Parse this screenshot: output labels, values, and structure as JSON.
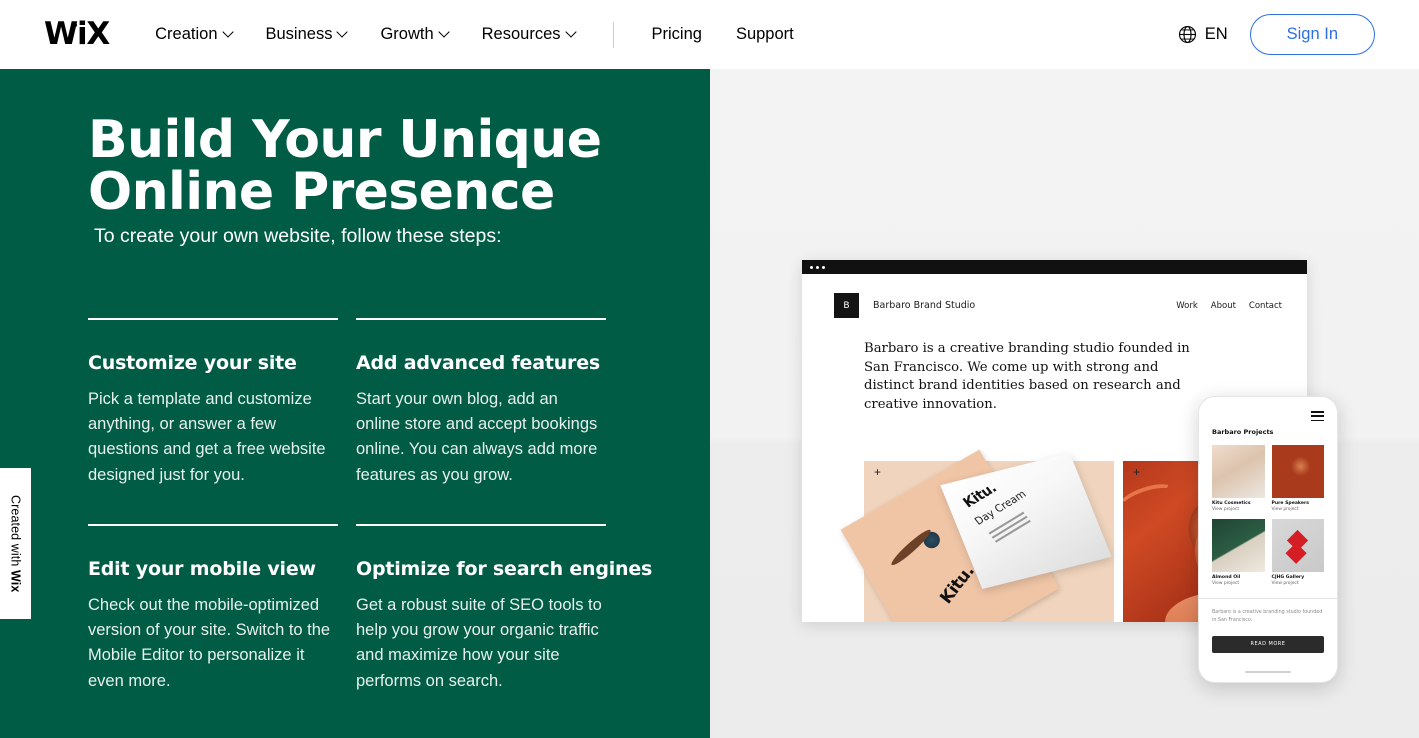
{
  "header": {
    "logo_text": "WiX",
    "nav_items": [
      {
        "label": "Creation",
        "has_chevron": true
      },
      {
        "label": "Business",
        "has_chevron": true
      },
      {
        "label": "Growth",
        "has_chevron": true
      },
      {
        "label": "Resources",
        "has_chevron": true
      }
    ],
    "nav_items_right": [
      {
        "label": "Pricing"
      },
      {
        "label": "Support"
      }
    ],
    "language": "EN",
    "signin_label": "Sign In"
  },
  "hero": {
    "title_line1": "Build Your Unique",
    "title_line2": "Online Presence",
    "subtitle": "To create your own website, follow these steps:",
    "cards": [
      {
        "title": "Customize your site",
        "body": "Pick a template and customize anything, or answer a few questions and get a free website designed just for you."
      },
      {
        "title": "Add advanced features",
        "body": "Start your own blog, add an online store and accept bookings online. You can always add more features as you grow."
      },
      {
        "title": "Edit your mobile view",
        "body": "Check out the mobile-optimized version of your site. Switch to the Mobile Editor to personalize it even more."
      },
      {
        "title": "Optimize for search engines",
        "body": "Get a robust suite of SEO tools to help you grow your organic traffic and maximize how your site performs on search."
      }
    ]
  },
  "created_badge": {
    "prefix": "Created with ",
    "brand": "Wix"
  },
  "preview": {
    "desktop": {
      "logo_initial": "B",
      "brand": "Barbaro Brand Studio",
      "nav": [
        "Work",
        "About",
        "Contact"
      ],
      "paragraph": "Barbaro is a creative branding studio founded in San Francisco. We come up with strong and distinct brand identities based on research and creative innovation.",
      "plus_symbol": "+",
      "product_brand": "Kitu.",
      "product_name": "Day Cream"
    },
    "mobile": {
      "section_title": "Barbaro Projects",
      "projects": [
        {
          "name": "Kitu Cosmetics",
          "link": "View project"
        },
        {
          "name": "Pure Speakers",
          "link": "View project"
        },
        {
          "name": "Almond Oil",
          "link": "View project"
        },
        {
          "name": "CJHG Gallery",
          "link": "View project"
        }
      ],
      "paragraph": "Barbaro is a creative branding studio founded in San Francisco.",
      "cta_label": "READ MORE"
    }
  },
  "colors": {
    "brand_green": "#005C45",
    "accent_blue": "#2F6FE4",
    "panel_gray": "#F2F2F2"
  }
}
